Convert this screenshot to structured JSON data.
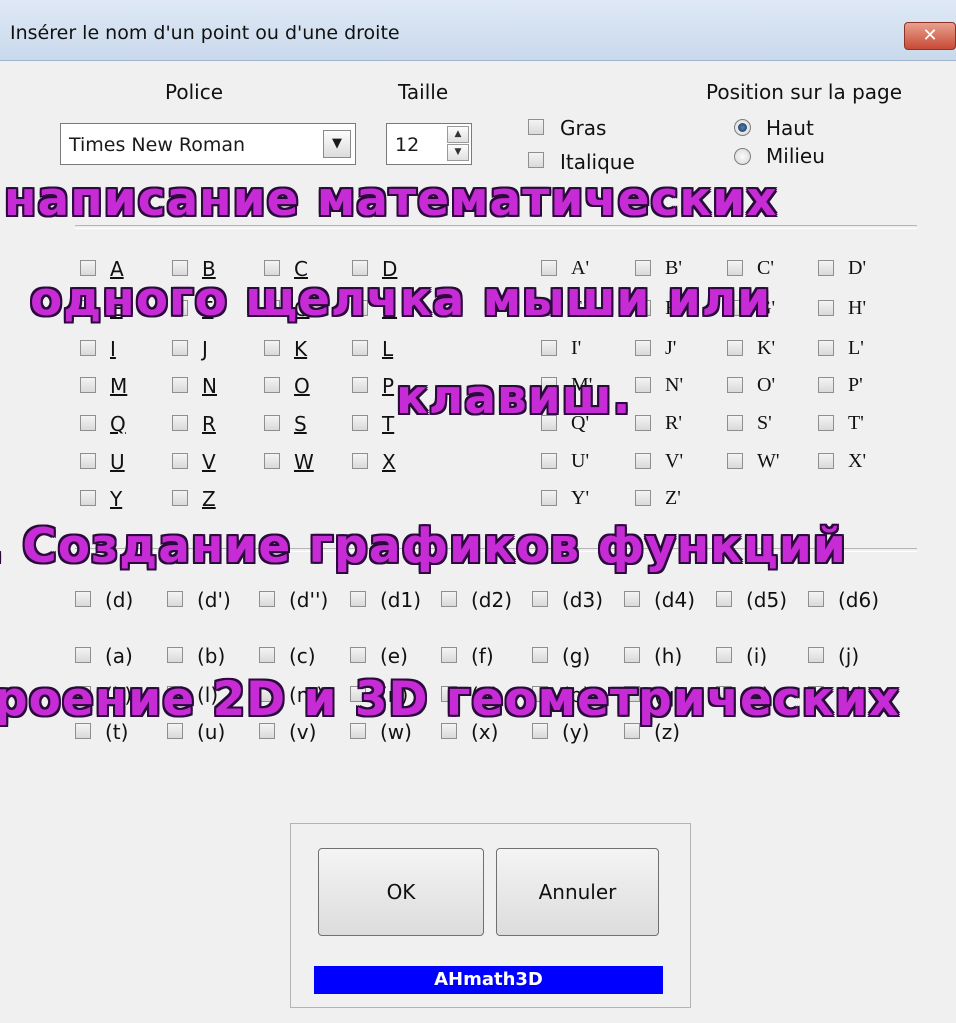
{
  "window": {
    "title": "Insérer le nom d'un point ou d'une droite",
    "close_glyph": "✕"
  },
  "font": {
    "label": "Police",
    "selected": "Times New Roman"
  },
  "size": {
    "label": "Taille",
    "value": "12"
  },
  "style": {
    "bold": "Gras",
    "italic": "Italique"
  },
  "position": {
    "label": "Position sur la page",
    "options": [
      "Haut",
      "Milieu"
    ],
    "selected": "Haut"
  },
  "points_plain": [
    "A",
    "B",
    "C",
    "D",
    "E",
    "F",
    "G",
    "H",
    "I",
    "J",
    "K",
    "L",
    "M",
    "N",
    "O",
    "P",
    "Q",
    "R",
    "S",
    "T",
    "U",
    "V",
    "W",
    "X",
    "Y",
    "Z"
  ],
  "points_prime": [
    "A'",
    "B'",
    "C'",
    "D'",
    "E'",
    "F'",
    "G'",
    "H'",
    "I'",
    "J'",
    "K'",
    "L'",
    "M'",
    "N'",
    "O'",
    "P'",
    "Q'",
    "R'",
    "S'",
    "T'",
    "U'",
    "V'",
    "W'",
    "X'",
    "Y'",
    "Z'"
  ],
  "lines_d": [
    "(d)",
    "(d')",
    "(d'')",
    "(d1)",
    "(d2)",
    "(d3)",
    "(d4)",
    "(d5)",
    "(d6)"
  ],
  "lines_letters": [
    "(a)",
    "(b)",
    "(c)",
    "(e)",
    "(f)",
    "(g)",
    "(h)",
    "(i)",
    "(j)",
    "(k)",
    "(l)",
    "(m)",
    "(n)",
    "(o)",
    "(p)",
    "(q)",
    "(r)",
    "(s)",
    "(t)",
    "(u)",
    "(v)",
    "(w)",
    "(x)",
    "(y)",
    "(z)"
  ],
  "buttons": {
    "ok": "OK",
    "cancel": "Annuler"
  },
  "brand": "AHmath3D",
  "overlay": {
    "line1": "написание математических",
    "line2": "одного щелчка мыши или",
    "line3": "клавиш.",
    "line4": ". Создание графиков функций",
    "line5": "роение 2D и 3D геометрических"
  },
  "colors": {
    "brand_bg": "#0000ff",
    "overlay_text": "#c72bd6",
    "overlay_outline": "#2a0a3a",
    "close_btn": "#c74a35"
  }
}
